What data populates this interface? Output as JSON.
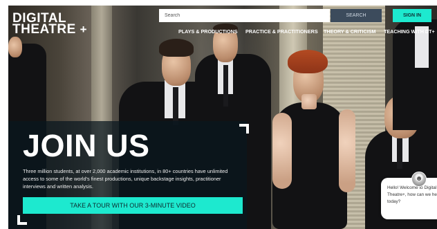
{
  "brand": {
    "logo_line1": "DIGITAL",
    "logo_line2": "THEATRE",
    "logo_plus": "+"
  },
  "header": {
    "search_placeholder": "Search",
    "search_button": "SEARCH",
    "signin_button": "SIGN IN"
  },
  "nav": {
    "items": [
      "PLAYS & PRODUCTIONS",
      "PRACTICE & PRACTITIONERS",
      "THEORY & CRITICISM",
      "TEACHING WITH DT+"
    ]
  },
  "hero": {
    "title": "JOIN US",
    "description": "Three million students, at over 2,000 academic institutions, in 80+ countries have unlimited access to some of the world's finest productions, unique backstage insights, practitioner interviews and written analysis.",
    "cta": "TAKE A TOUR WITH OUR 3-MINUTE VIDEO"
  },
  "chat": {
    "line1": "Hello! Welcome to Digital",
    "line2": "Theatre+, how can we help",
    "line3": "today?"
  },
  "colors": {
    "accent": "#1de9cf",
    "search_button_bg": "#3c4b5c",
    "overlay": "#08161e"
  },
  "icons": {
    "avatar": "person-avatar-icon"
  }
}
